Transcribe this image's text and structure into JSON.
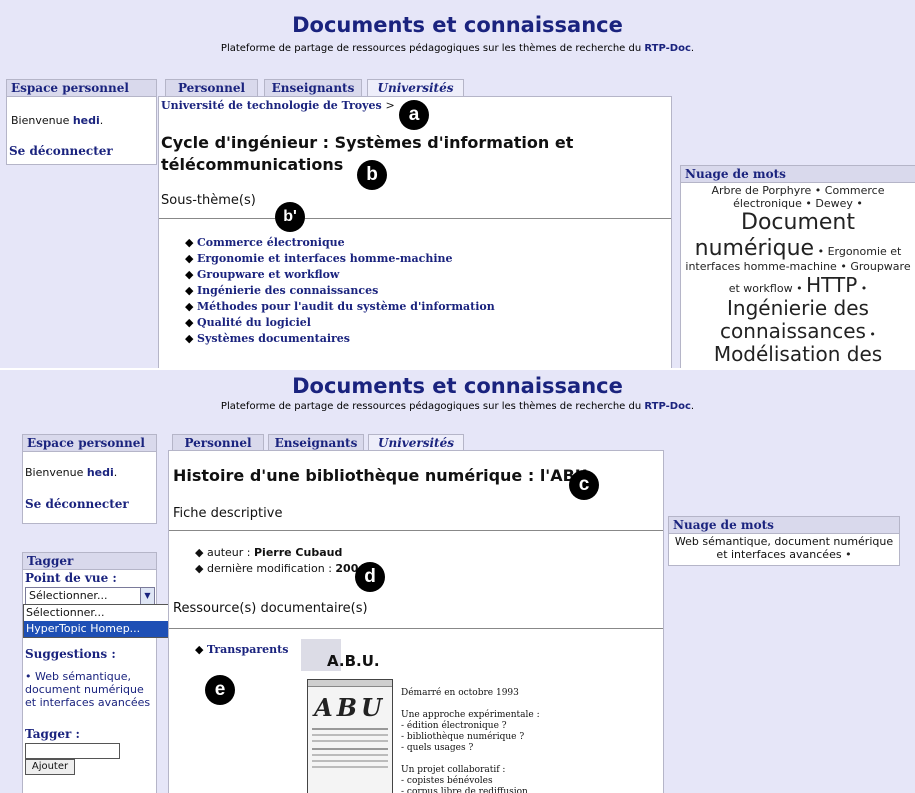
{
  "site": {
    "title": "Documents et connaissance",
    "subtitle_prefix": "Plateforme de partage de ressources pédagogiques sur les thèmes de recherche du",
    "subtitle_link": "RTP-Doc",
    "subtitle_suffix": "."
  },
  "tabs": [
    "Personnel",
    "Enseignants",
    "Universités"
  ],
  "personal": {
    "heading": "Espace personnel",
    "welcome": "Bienvenue",
    "user": "hedi",
    "dot": ".",
    "logout": "Se déconnecter"
  },
  "top": {
    "breadcrumb": "Université de technologie de Troyes",
    "breadcrumb_sep": ">",
    "title_line1": "Cycle d'ingénieur : Systèmes d'information et",
    "title_line2": "télécommunications",
    "section": "Sous-thème(s)",
    "subthemes": [
      "Commerce électronique",
      "Ergonomie et interfaces homme-machine",
      "Groupware et workflow",
      "Ingénierie des connaissances",
      "Méthodes pour l'audit du système d'information",
      "Qualité du logiciel",
      "Systèmes documentaires"
    ],
    "cloud_heading": "Nuage de mots",
    "cloud": [
      {
        "text": "Arbre de Porphyre",
        "size": 11
      },
      {
        "text": "Commerce électronique",
        "size": 11
      },
      {
        "text": "Dewey",
        "size": 11
      },
      {
        "text": "Document numérique",
        "size": 22
      },
      {
        "text": "Ergonomie et interfaces homme-machine",
        "size": 11
      },
      {
        "text": "Groupware et workflow",
        "size": 11
      },
      {
        "text": "HTTP",
        "size": 20
      },
      {
        "text": "Ingénierie des connaissances",
        "size": 20
      },
      {
        "text": "Modélisation des connaissances",
        "size": 20
      }
    ],
    "cloud_sep": "•"
  },
  "bottom": {
    "title": "Histoire d'une bibliothèque numérique : l'ABU",
    "section1": "Fiche descriptive",
    "author_label": "auteur :",
    "author": "Pierre Cubaud",
    "modif_label": "dernière modification :",
    "modif": "2004",
    "section2": "Ressource(s) documentaire(s)",
    "resource": "Transparents",
    "cloud_heading": "Nuage de mots",
    "cloud_text": "Web sémantique, document numérique et interfaces avancées",
    "cloud_sep": "•"
  },
  "tagger": {
    "heading": "Tagger",
    "pov_label": "Point de vue :",
    "select_value": "Sélectionner...",
    "options": [
      "Sélectionner...",
      "HyperTopic Homep..."
    ],
    "suggestions_label": "Suggestions :",
    "suggestion": "Web sémantique, document numérique et interfaces avancées",
    "suggestion_prefix": "•",
    "tag_label": "Tagger :",
    "tag_value": "",
    "add_button": "Ajouter"
  },
  "slide": {
    "title": "A.B.U.",
    "lines": [
      "Démarré en octobre 1993",
      "",
      "Une approche expérimentale :",
      "- édition électronique ?",
      "- bibliothèque numérique ?",
      "- quels usages ?",
      "",
      "Un projet collaboratif :",
      "- copistes bénévoles",
      "- corpus libre de rediffusion"
    ],
    "thumb_letters": "ABU"
  },
  "markers": [
    "a",
    "b",
    "b'",
    "c",
    "d",
    "e"
  ]
}
